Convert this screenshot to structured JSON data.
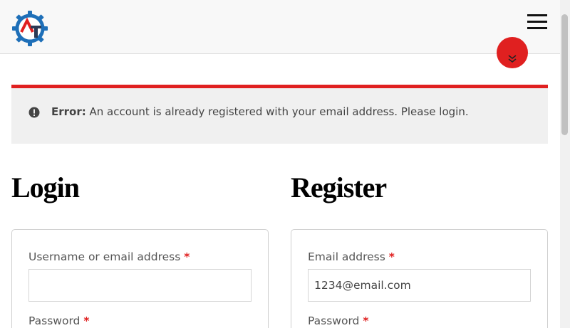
{
  "header": {
    "logo_icon": "gear-logo-icon",
    "logo_letters": "AT",
    "menu_icon": "hamburger-menu-icon"
  },
  "colors": {
    "accent": "#e02020",
    "logo_blue": "#1e6fb8",
    "logo_dark": "#2b3a55"
  },
  "notice": {
    "icon": "exclamation-circle-icon",
    "label": "Error:",
    "message": " An account is already registered with your email address. Please login."
  },
  "login": {
    "title": "Login",
    "username_label": "Username or email address",
    "username_value": "",
    "password_label": "Password",
    "required_mark": "*"
  },
  "register": {
    "title": "Register",
    "email_label": "Email address",
    "email_value": "1234@email.com",
    "password_label": "Password",
    "required_mark": "*"
  }
}
